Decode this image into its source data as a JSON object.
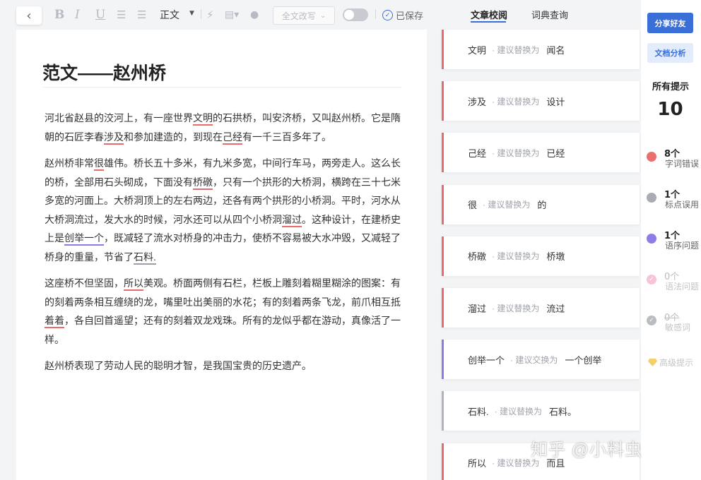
{
  "toolbar": {
    "back_icon": "chevron-left-icon",
    "font_name": "正文",
    "rewrite_label": "全文改写",
    "saved_label": "已保存"
  },
  "tabs": [
    "文章校阅",
    "词典查询"
  ],
  "document": {
    "title": "范文——赵州桥",
    "paragraphs": [
      [
        {
          "t": "河北省赵县的洨河上，有一座世界"
        },
        {
          "t": "文明",
          "e": "red"
        },
        {
          "t": "的石拱桥，叫安济桥，又叫赵州桥。它是隋朝的石匠李春"
        },
        {
          "t": "涉及",
          "e": "red"
        },
        {
          "t": "和参加建造的，到现在"
        },
        {
          "t": "己经",
          "e": "red"
        },
        {
          "t": "有一千三百多年了。"
        }
      ],
      [
        {
          "t": "赵州桥非常"
        },
        {
          "t": "很",
          "e": "red"
        },
        {
          "t": "雄伟。桥长五十多米，有九米多宽，中间行车马，两旁走人。这么长的桥，全部用石头砌成，下面没有"
        },
        {
          "t": "桥礅",
          "e": "red"
        },
        {
          "t": "，只有一个拱形的大桥洞，横跨在三十七米多宽的河面上。大桥洞顶上的左右两边，还各有两个拱形的小桥洞。平时，河水从大桥洞流过，发大水的时候，河水还可以从四个小桥洞"
        },
        {
          "t": "溜过",
          "e": "red"
        },
        {
          "t": "。这种设计，在建桥史上是"
        },
        {
          "t": "创举一个",
          "e": "purple"
        },
        {
          "t": "，既减轻了流水对桥身的冲击力，使桥不容易被大水冲毁，又减轻了桥身的重量，节省了"
        },
        {
          "t": "石料.",
          "e": "gray"
        }
      ],
      [
        {
          "t": "这座桥不但坚固，"
        },
        {
          "t": "所以",
          "e": "red"
        },
        {
          "t": "美观。桥面两侧有石栏，栏板上雕刻着糊里糊涂的图案：有的刻着两条相互缠绕的龙，嘴里吐出美丽的水花；有的刻着两条飞龙，前爪相互抵"
        },
        {
          "t": "着着",
          "e": "red"
        },
        {
          "t": "，各自回首遥望；还有的刻着双龙戏珠。所有的龙似乎都在游动，真像活了一样。"
        }
      ],
      [
        {
          "t": "赵州桥表现了劳动人民的聪明才智，是我国宝贵的历史遗产。"
        }
      ]
    ]
  },
  "suggestions": [
    {
      "original": "文明",
      "hint": "· 建议替换为",
      "suggestion": "闻名",
      "color": "red"
    },
    {
      "original": "涉及",
      "hint": "· 建议替换为",
      "suggestion": "设计",
      "color": "red"
    },
    {
      "original": "己经",
      "hint": "· 建议替换为",
      "suggestion": "已经",
      "color": "red"
    },
    {
      "original": "很",
      "hint": "· 建议替换为",
      "suggestion": "的",
      "color": "red"
    },
    {
      "original": "桥礅",
      "hint": "· 建议替换为",
      "suggestion": "桥墩",
      "color": "red"
    },
    {
      "original": "溜过",
      "hint": "· 建议替换为",
      "suggestion": "流过",
      "color": "red"
    },
    {
      "original": "创举一个",
      "hint": "· 建议交换为",
      "suggestion": "一个创举",
      "color": "purple"
    },
    {
      "original": "石料.",
      "hint": "· 建议替换为",
      "suggestion": "石料。",
      "color": "gray"
    },
    {
      "original": "所以",
      "hint": "· 建议替换为",
      "suggestion": "而且",
      "color": "red"
    }
  ],
  "side": {
    "share_label": "分享好友",
    "analysis_label": "文档分析",
    "all_label": "所有提示",
    "all_count": "10",
    "categories": [
      {
        "count": "8个",
        "label": "字词错误",
        "color": "#ea6f6f"
      },
      {
        "count": "1个",
        "label": "标点误用",
        "color": "#a9adb3"
      },
      {
        "count": "1个",
        "label": "语序问题",
        "color": "#8d7de8"
      },
      {
        "count": "0个",
        "label": "语法问题",
        "color": "#f6c3d8"
      },
      {
        "count": "0个",
        "label": "敏感词",
        "color": "#b9bcc1"
      }
    ],
    "advanced_label": "高级提示"
  },
  "watermark": "知乎 @小料虫"
}
